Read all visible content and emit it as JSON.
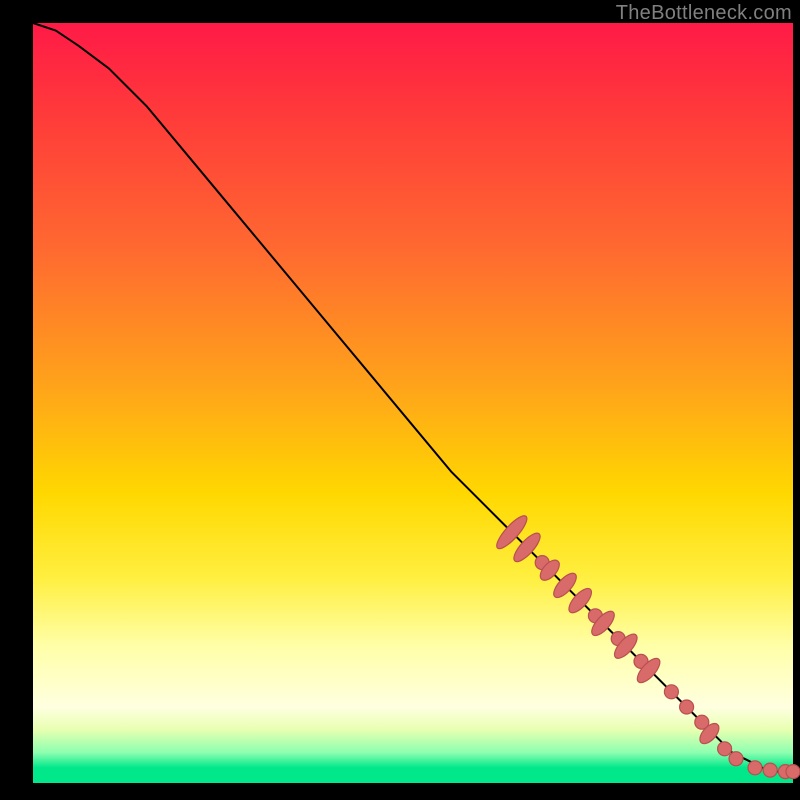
{
  "watermark": "TheBottleneck.com",
  "colors": {
    "gradient_top": "#ff1a47",
    "gradient_mid_orange": "#ffa41a",
    "gradient_yellow": "#ffef40",
    "gradient_pale": "#ffffe0",
    "gradient_green": "#00e88a",
    "curve": "#000000",
    "marker_fill": "#d86a6a",
    "marker_stroke": "#b94f4f",
    "frame": "#000000"
  },
  "chart_data": {
    "type": "line",
    "title": "",
    "xlabel": "",
    "ylabel": "",
    "xlim": [
      0,
      100
    ],
    "ylim": [
      0,
      100
    ],
    "grid": false,
    "legend": false,
    "series": [
      {
        "name": "curve",
        "x": [
          0,
          3,
          6,
          10,
          15,
          20,
          25,
          30,
          35,
          40,
          45,
          50,
          55,
          60,
          63,
          65,
          68,
          70,
          72,
          74,
          76,
          78,
          80,
          82,
          84,
          86,
          88,
          90,
          92,
          94,
          96,
          98,
          100
        ],
        "y": [
          100,
          99,
          97,
          94,
          89,
          83,
          77,
          71,
          65,
          59,
          53,
          47,
          41,
          36,
          33,
          31,
          28,
          26,
          24,
          22,
          20,
          18,
          16,
          14,
          12,
          10,
          8,
          6,
          4,
          3,
          2,
          1.5,
          1.5
        ]
      }
    ],
    "markers": [
      {
        "x": 63,
        "y": 33,
        "elong": true,
        "len": 3.5
      },
      {
        "x": 65,
        "y": 31,
        "elong": true,
        "len": 3.0
      },
      {
        "x": 67,
        "y": 29,
        "elong": false
      },
      {
        "x": 68,
        "y": 28,
        "elong": true,
        "len": 2.0
      },
      {
        "x": 70,
        "y": 26,
        "elong": true,
        "len": 2.5
      },
      {
        "x": 72,
        "y": 24,
        "elong": true,
        "len": 2.5
      },
      {
        "x": 74,
        "y": 22,
        "elong": false
      },
      {
        "x": 75,
        "y": 21,
        "elong": true,
        "len": 2.5
      },
      {
        "x": 77,
        "y": 19,
        "elong": false
      },
      {
        "x": 78,
        "y": 18,
        "elong": true,
        "len": 2.5
      },
      {
        "x": 80,
        "y": 16,
        "elong": false
      },
      {
        "x": 81,
        "y": 14.8,
        "elong": true,
        "len": 2.5
      },
      {
        "x": 84,
        "y": 12,
        "elong": false
      },
      {
        "x": 86,
        "y": 10,
        "elong": false
      },
      {
        "x": 88,
        "y": 8,
        "elong": false
      },
      {
        "x": 89,
        "y": 6.5,
        "elong": true,
        "len": 2.0
      },
      {
        "x": 91,
        "y": 4.5,
        "elong": false
      },
      {
        "x": 92.5,
        "y": 3.2,
        "elong": false
      },
      {
        "x": 95,
        "y": 2.0,
        "elong": false
      },
      {
        "x": 97,
        "y": 1.7,
        "elong": false
      },
      {
        "x": 99,
        "y": 1.5,
        "elong": false
      },
      {
        "x": 100,
        "y": 1.5,
        "elong": false
      }
    ]
  }
}
